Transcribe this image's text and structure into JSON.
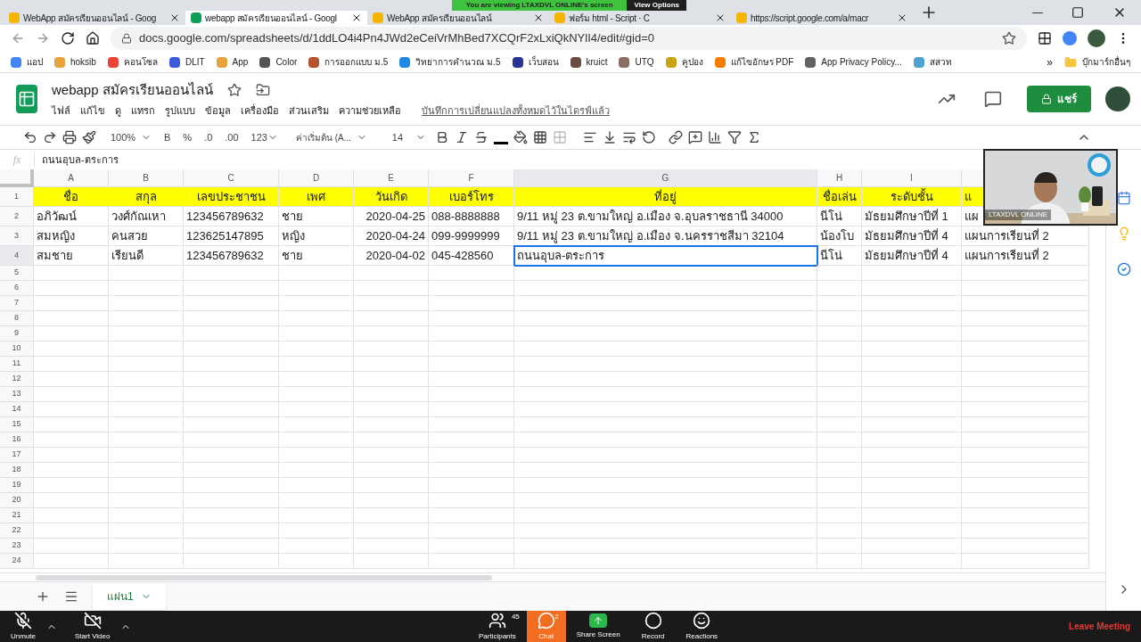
{
  "zoom_banner": {
    "text": "You are viewing LTAXDVL ONLINE's screen",
    "button": "View Options"
  },
  "browser": {
    "tabs": [
      {
        "title": "WebApp สมัครเรียนออนไลน์ - Goog",
        "selected": false
      },
      {
        "title": "webapp สมัครเรียนออนไลน์ - Googl",
        "selected": true
      },
      {
        "title": "WebApp สมัครเรียนออนไลน์",
        "selected": false
      },
      {
        "title": "ฟอร์ม html - Script · C",
        "selected": false
      },
      {
        "title": "https://script.google.com/a/macr",
        "selected": false
      }
    ],
    "url": "docs.google.com/spreadsheets/d/1ddLO4i4Pn4JWd2eCeiVrMhBed7XCQrF2xLxiQkNYlI4/edit#gid=0",
    "bookmarks": [
      {
        "label": "แอป",
        "color": "#4285f4"
      },
      {
        "label": "hoksib",
        "color": "#e8a33c"
      },
      {
        "label": "คอนโซล",
        "color": "#ea4335"
      },
      {
        "label": "DLIT",
        "color": "#3b5bdb"
      },
      {
        "label": "App",
        "color": "#e8a33c"
      },
      {
        "label": "Color",
        "color": "#555555"
      },
      {
        "label": "การออกแบบ ม.5",
        "color": "#b5542c"
      },
      {
        "label": "วิทยาการคำนวณ ม.5",
        "color": "#1e88e5"
      },
      {
        "label": "เว็บสอน",
        "color": "#283593"
      },
      {
        "label": "kruict",
        "color": "#6d4c41"
      },
      {
        "label": "UTQ",
        "color": "#8d6e63"
      },
      {
        "label": "คูปอง",
        "color": "#c8a415"
      },
      {
        "label": "แก้ไขอักษร PDF",
        "color": "#f57c00"
      },
      {
        "label": "App Privacy Policy...",
        "color": "#616161"
      },
      {
        "label": "สสวท",
        "color": "#4fa3d1"
      }
    ],
    "more": "»",
    "other_bookmarks": "บุ๊กมาร์กอื่นๆ"
  },
  "sheet": {
    "title": "webapp สมัครเรียนออนไลน์",
    "menu": [
      "ไฟล์",
      "แก้ไข",
      "ดู",
      "แทรก",
      "รูปแบบ",
      "ข้อมูล",
      "เครื่องมือ",
      "ส่วนเสริม",
      "ความช่วยเหลือ"
    ],
    "save_note": "บันทึกการเปลี่ยนแปลงทั้งหมดไว้ในไดรฟ์แล้ว",
    "share": "แชร์",
    "toolbar": {
      "zoom": "100%",
      "bold_label": "B",
      "percent": "%",
      "decrease_decimal": ".0",
      "increase_decimal": ".00",
      "more_formats": "123",
      "font": "ค่าเริ่มต้น (A...",
      "font_size": "14"
    },
    "formula_bar": {
      "label": "fx",
      "value": "ถนนอุบล-ตระการ"
    },
    "columns": [
      {
        "letter": "A",
        "selected": false
      },
      {
        "letter": "B",
        "selected": false
      },
      {
        "letter": "C",
        "selected": false
      },
      {
        "letter": "D",
        "selected": false
      },
      {
        "letter": "E",
        "selected": false
      },
      {
        "letter": "F",
        "selected": false
      },
      {
        "letter": "G",
        "selected": true
      },
      {
        "letter": "H",
        "selected": false
      },
      {
        "letter": "I",
        "selected": false
      },
      {
        "selected": false
      }
    ],
    "rows": [
      {
        "number": "1",
        "selected": false,
        "kind": "header",
        "cells": [
          "ชื่อ",
          "สกุล",
          "เลขประชาชน",
          "เพศ",
          "วันเกิด",
          "เบอร์โทร",
          "ที่อยู่",
          "ชื่อเล่น",
          "ระดับชั้น",
          "แ"
        ]
      },
      {
        "number": "2",
        "selected": false,
        "kind": "data",
        "cells": [
          "อภิวัฒน์",
          "วงศ์กัณเหา",
          "123456789632",
          "ชาย",
          "2020-04-25",
          "088-8888888",
          "9/11 หมู่ 23 ต.ขามใหญ่ อ.เมือง จ.อุบลราชธานี 34000",
          "นีโน่",
          "มัธยมศึกษาปีที่ 1",
          "แผ"
        ]
      },
      {
        "number": "3",
        "selected": false,
        "kind": "data",
        "cells": [
          "สมหญิง",
          "คนสวย",
          "123625147895",
          "หญิง",
          "2020-04-24",
          "099-9999999",
          "9/11 หมู่ 23 ต.ขามใหญ่ อ.เมือง จ.นครราชสีมา 32104",
          "น้องโบ",
          "มัธยมศึกษาปีที่ 4",
          "แผนการเรียนที่ 2"
        ]
      },
      {
        "number": "4",
        "selected": true,
        "kind": "data",
        "cells": [
          "สมชาย",
          "เรียนดี",
          "123456789632",
          "ชาย",
          "2020-04-02",
          "045-428560",
          "ถนนอุบล-ตระการ",
          "นีโน่",
          "มัธยมศึกษาปีที่ 4",
          "แผนการเรียนที่ 2"
        ]
      },
      {
        "number": "5"
      },
      {
        "number": "6"
      },
      {
        "number": "7"
      },
      {
        "number": "8"
      },
      {
        "number": "9"
      },
      {
        "number": "10"
      },
      {
        "number": "11"
      },
      {
        "number": "12"
      },
      {
        "number": "13"
      },
      {
        "number": "14"
      },
      {
        "number": "15"
      },
      {
        "number": "16"
      },
      {
        "number": "17"
      },
      {
        "number": "18"
      },
      {
        "number": "19"
      },
      {
        "number": "20"
      },
      {
        "number": "21"
      },
      {
        "number": "22"
      },
      {
        "number": "23"
      },
      {
        "number": "24"
      }
    ],
    "sheet_tabs": [
      {
        "label": "แผ่น1",
        "selected": true
      }
    ]
  },
  "video": {
    "name": "LTAXDVL ONLINE"
  },
  "meeting_bar": {
    "left": [
      {
        "label": "Unmute",
        "kind": "mic"
      },
      {
        "label": "Start Video",
        "kind": "video"
      }
    ],
    "center": [
      {
        "label": "Participants",
        "kind": "participants",
        "badge": "45",
        "selected": false
      },
      {
        "label": "Chat",
        "kind": "chat",
        "badge": "2",
        "selected": true
      },
      {
        "label": "Share Screen",
        "kind": "share",
        "selected": false
      },
      {
        "label": "Record",
        "kind": "record",
        "selected": false
      },
      {
        "label": "Reactions",
        "kind": "reactions",
        "selected": false
      }
    ],
    "leave": "Leave Meeting"
  }
}
